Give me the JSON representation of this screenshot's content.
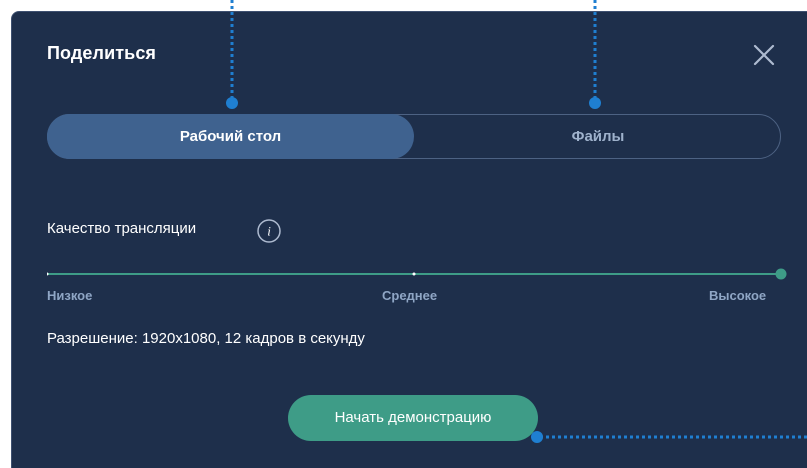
{
  "dialog": {
    "title": "Поделиться"
  },
  "tabs": [
    {
      "label": "Рабочий стол",
      "active": true
    },
    {
      "label": "Файлы",
      "active": false
    }
  ],
  "quality": {
    "label": "Качество трансляции",
    "levels": [
      "Низкое",
      "Среднее",
      "Высокое"
    ],
    "selected": "Высокое",
    "value_fraction": 1.0
  },
  "resolution_text": "Разрешение: 1920x1080, 12 кадров в секунду",
  "start_button_label": "Начать демонстрацию",
  "colors": {
    "dialog_bg": "#1e2f4b",
    "tab_active": "#3f628f",
    "slider_track": "#3e9c87",
    "accent_button": "#3e9c87",
    "callout_blue": "#1f7fd1"
  },
  "icons": {
    "close": "close-icon",
    "info": "info-icon"
  }
}
